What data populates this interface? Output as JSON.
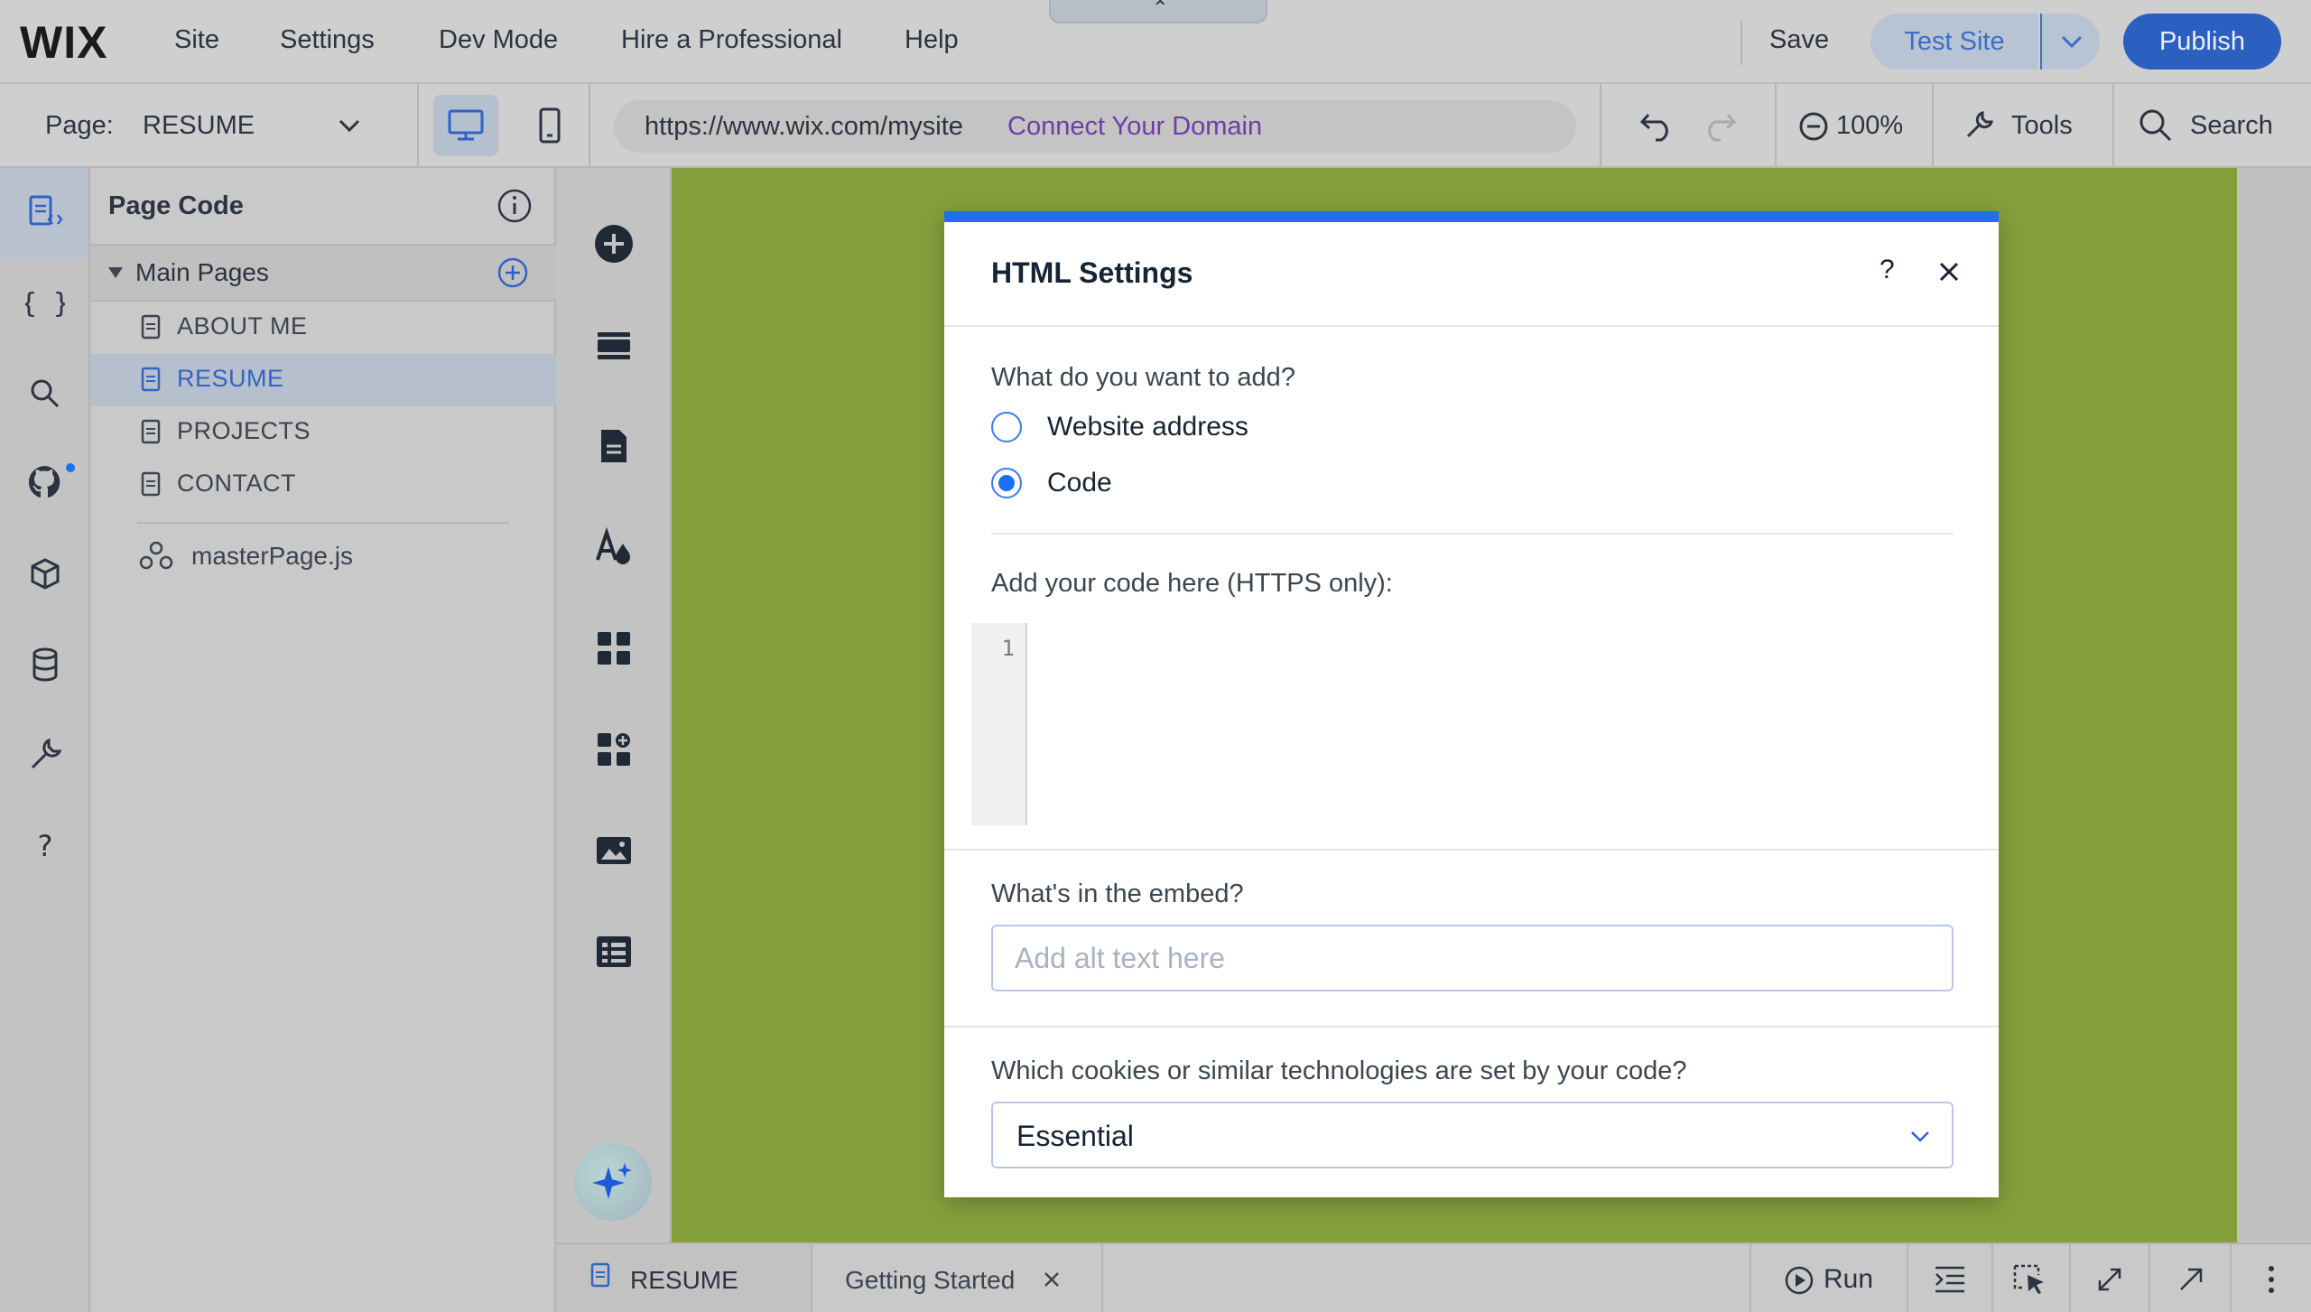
{
  "topbar": {
    "logo": "WIX",
    "menu": [
      "Site",
      "Settings",
      "Dev Mode",
      "Hire a Professional",
      "Help"
    ],
    "collapse_glyph": "⌃",
    "save_label": "Save",
    "test_site_label": "Test Site",
    "publish_label": "Publish"
  },
  "pagebar": {
    "page_label": "Page:",
    "page_value": "RESUME",
    "url": "https://www.wix.com/mysite",
    "connect_domain": "Connect Your Domain",
    "zoom": "100%",
    "tools_label": "Tools",
    "search_label": "Search"
  },
  "left_rail": {
    "icons": [
      "page-code-icon",
      "braces-icon",
      "search-icon",
      "github-icon",
      "packages-icon",
      "database-icon",
      "developer-tools-icon",
      "help-icon"
    ]
  },
  "code_panel": {
    "title": "Page Code",
    "section_label": "Main Pages",
    "pages": [
      "ABOUT ME",
      "RESUME",
      "PROJECTS",
      "CONTACT"
    ],
    "active_page": "RESUME",
    "master_file": "masterPage.js"
  },
  "add_strip": {
    "icons": [
      "add-elements-icon",
      "sections-icon",
      "pages-icon",
      "site-design-icon",
      "apps-icon",
      "add-apps-icon",
      "media-icon",
      "cms-icon",
      "ai-assistant-icon"
    ]
  },
  "bottombar": {
    "tabs": [
      {
        "label": "RESUME"
      },
      {
        "label": "Getting Started"
      }
    ],
    "run_label": "Run"
  },
  "dialog": {
    "title": "HTML Settings",
    "help_glyph": "?",
    "question": "What do you want to add?",
    "options": [
      {
        "label": "Website address",
        "checked": false
      },
      {
        "label": "Code",
        "checked": true
      }
    ],
    "code_label": "Add your code here (HTTPS only):",
    "line_number": "1",
    "embed_label": "What's in the embed?",
    "alt_placeholder": "Add alt text here",
    "cookies_label": "Which cookies or similar technologies are set by your code?",
    "cookies_value": "Essential"
  },
  "colors": {
    "primary": "#1e6ef0",
    "canvas": "#83a03d",
    "publish": "#2b5fc0",
    "connect_domain": "#6b3fa8"
  }
}
